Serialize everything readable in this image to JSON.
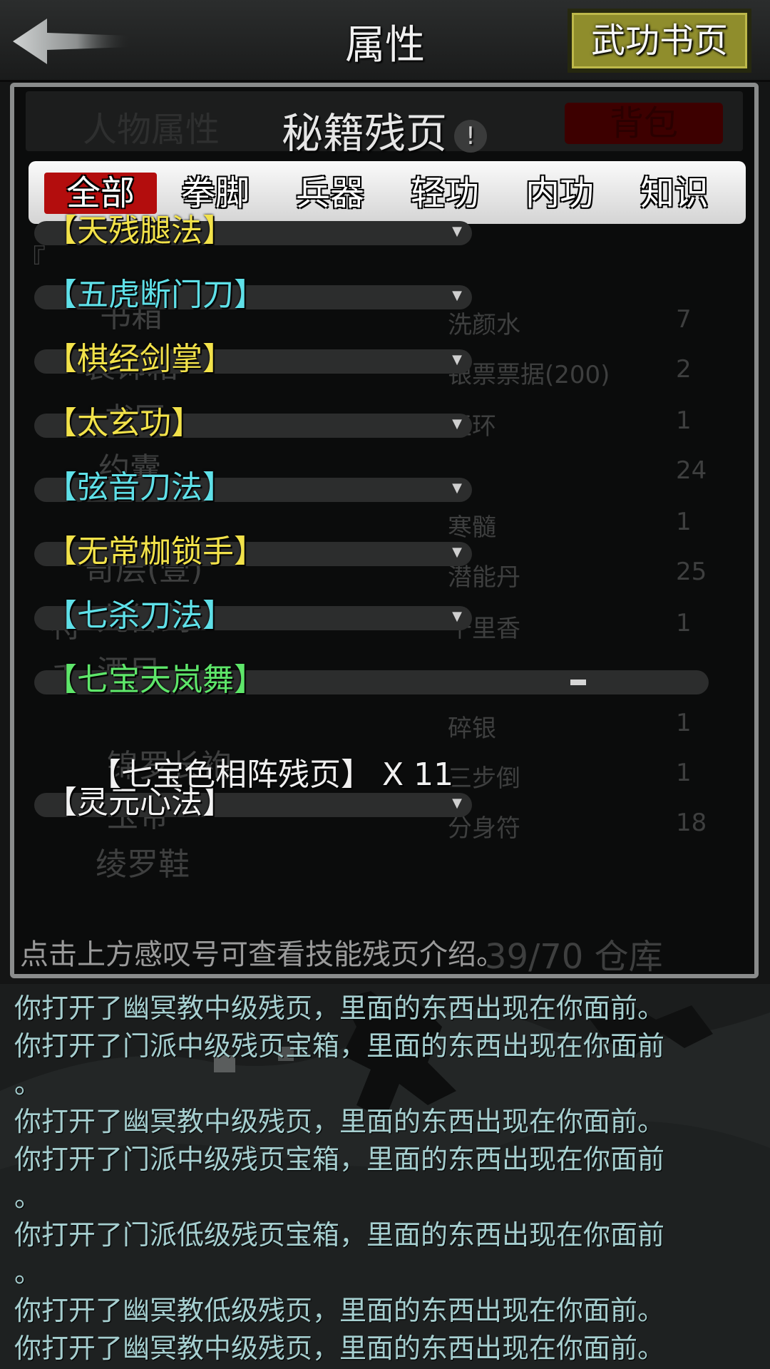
{
  "header": {
    "title": "属性",
    "back_icon": "arrow-left-icon",
    "book_button_label": "武功书页"
  },
  "panel": {
    "header_center": "秘籍残页",
    "info_icon_text": "!",
    "left_tab_label": "人物属性",
    "right_tab_label": "背包",
    "categories": [
      {
        "label": "全部",
        "active": true
      },
      {
        "label": "拳脚",
        "active": false
      },
      {
        "label": "兵器",
        "active": false
      },
      {
        "label": "轻功",
        "active": false
      },
      {
        "label": "内功",
        "active": false
      },
      {
        "label": "知识",
        "active": false
      }
    ],
    "skills": [
      {
        "name": "【天残腿法】",
        "color": "#f2e24a",
        "expanded": false
      },
      {
        "name": "【五虎断门刀】",
        "color": "#5fe0e8",
        "expanded": false
      },
      {
        "name": "【棋经剑掌】",
        "color": "#f2e24a",
        "expanded": false
      },
      {
        "name": "【太玄功】",
        "color": "#f2e24a",
        "expanded": false
      },
      {
        "name": "【弦音刀法】",
        "color": "#5fe0e8",
        "expanded": false
      },
      {
        "name": "【无常枷锁手】",
        "color": "#f2e24a",
        "expanded": false
      },
      {
        "name": "【七杀刀法】",
        "color": "#5fe0e8",
        "expanded": false
      },
      {
        "name": "【七宝天岚舞】",
        "color": "#5ee66a",
        "expanded": true
      },
      {
        "name": "【灵元心法】",
        "color": "#f2f2f2",
        "expanded": false
      }
    ],
    "expanded_subitem": "【七宝色相阵残页】 X 11",
    "hint": "点击上方感叹号可查看技能残页介绍。",
    "background_ghost": {
      "top_line": "『",
      "left_items": [
        "书箱",
        "装饰箱",
        "书匣",
        "约囊",
        "笥层(壹)",
        "九咎剑",
        "酒尸",
        "特",
        "香",
        "锦罗长袍",
        "玉带",
        "绫罗鞋"
      ],
      "right_items": [
        {
          "name": "洗颜水",
          "count": "7"
        },
        {
          "name": "银票票据(200)",
          "count": "2"
        },
        {
          "name": "玉环",
          "count": "1"
        },
        {
          "name": "",
          "count": "24"
        },
        {
          "name": "寒髓",
          "count": "1"
        },
        {
          "name": "潜能丹",
          "count": "25"
        },
        {
          "name": "千里香",
          "count": "1"
        },
        {
          "name": "碎银",
          "count": "1"
        },
        {
          "name": "三步倒",
          "count": "1"
        },
        {
          "name": "分身符",
          "count": "18"
        }
      ],
      "capacity": "39/70 仓库"
    }
  },
  "log": {
    "lines": [
      "你打开了幽冥教中级残页，里面的东西出现在你面前。",
      "你打开了门派中级残页宝箱，里面的东西出现在你面前\n。",
      "你打开了幽冥教中级残页，里面的东西出现在你面前。",
      "你打开了门派中级残页宝箱，里面的东西出现在你面前\n。",
      "你打开了门派低级残页宝箱，里面的东西出现在你面前\n。",
      "你打开了幽冥教低级残页，里面的东西出现在你面前。",
      "你打开了幽冥教中级残页，里面的东西出现在你面前。"
    ]
  }
}
